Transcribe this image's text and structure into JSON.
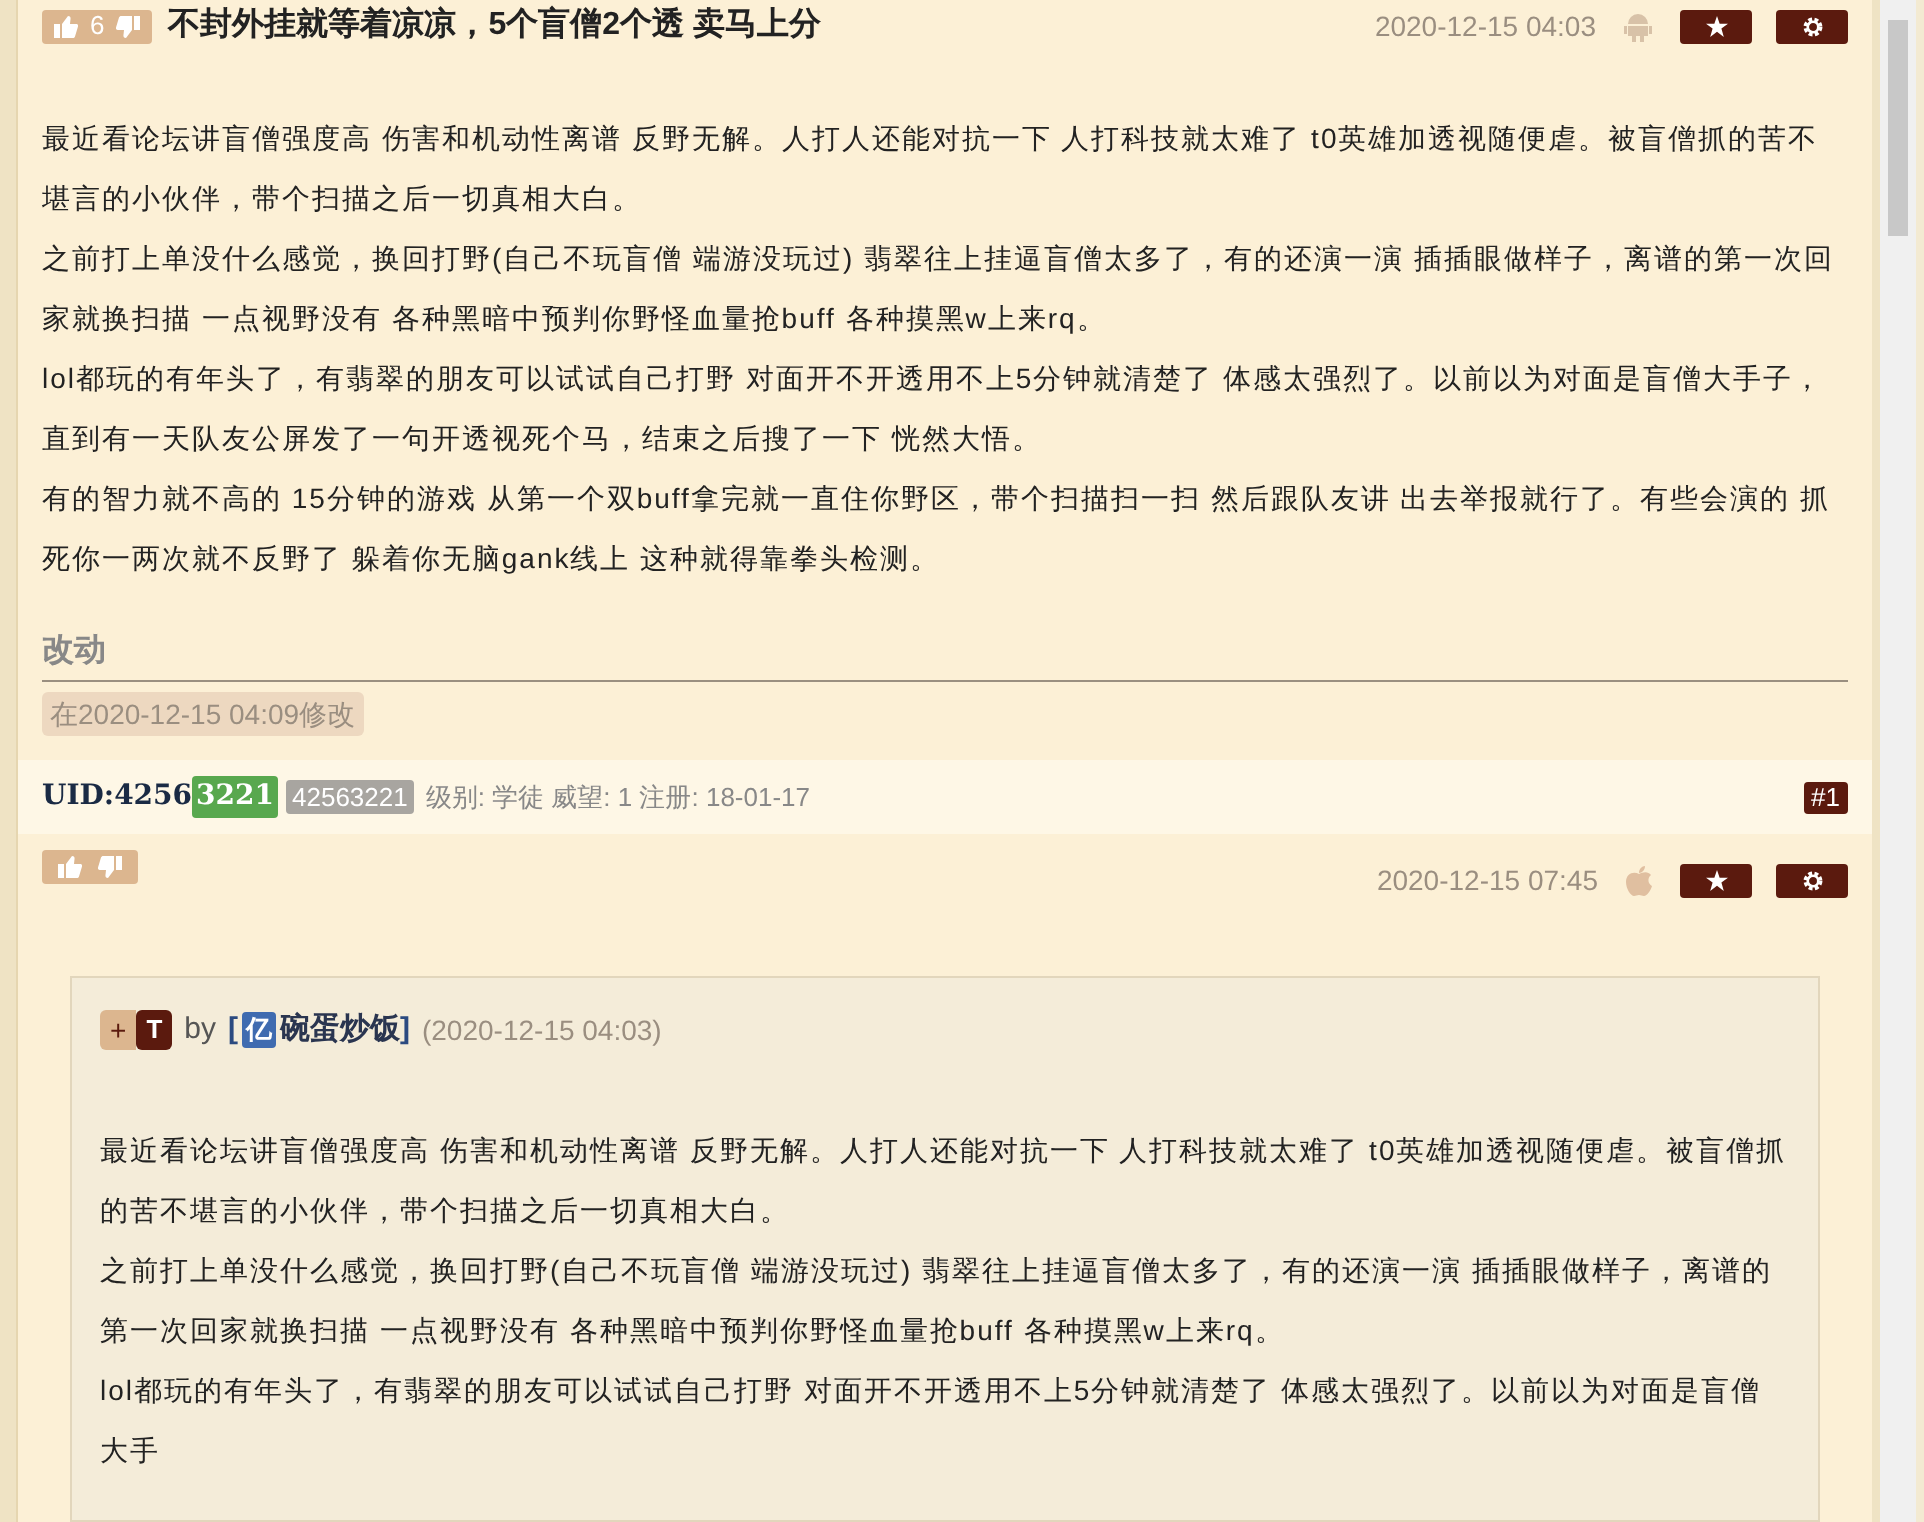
{
  "post": {
    "votes": "6",
    "title": "不封外挂就等着凉凉，5个盲僧2个透 卖马上分",
    "date": "2020-12-15 04:03",
    "device": {
      "kind": "android"
    },
    "paragraphs": [
      "最近看论坛讲盲僧强度高 伤害和机动性离谱 反野无解。人打人还能对抗一下 人打科技就太难了 t0英雄加透视随便虐。被盲僧抓的苦不堪言的小伙伴，带个扫描之后一切真相大白。",
      "之前打上单没什么感觉，换回打野(自己不玩盲僧 端游没玩过) 翡翠往上挂逼盲僧太多了，有的还演一演 插插眼做样子，离谱的第一次回家就换扫描 一点视野没有 各种黑暗中预判你野怪血量抢buff 各种摸黑w上来rq。",
      "lol都玩的有年头了，有翡翠的朋友可以试试自己打野 对面开不开透用不上5分钟就清楚了 体感太强烈了。以前以为对面是盲僧大手子，直到有一天队友公屏发了一句开透视死个马，结束之后搜了一下 恍然大悟。",
      "有的智力就不高的 15分钟的游戏 从第一个双buff拿完就一直住你野区，带个扫描扫一扫 然后跟队友讲 出去举报就行了。有些会演的 抓死你一两次就不反野了 躲着你无脑gank线上 这种就得靠拳头检测。"
    ],
    "edit_heading": "改动",
    "edit_note": "在2020-12-15 04:09修改"
  },
  "author": {
    "uid_prefix": "UID:4256",
    "uid_highlight": "3221",
    "uid_full": "42563221",
    "meta": "级别: 学徒 威望: 1 注册: 18-01-17",
    "floor": "#1"
  },
  "reply": {
    "date": "2020-12-15 07:45",
    "device": {
      "kind": "apple"
    },
    "quote": {
      "plus": "+",
      "tag": "T",
      "by": "by",
      "open": "[",
      "avatar": "亿",
      "user": "碗蛋炒饭",
      "close": "]",
      "date": "(2020-12-15 04:03)",
      "paragraphs": [
        "最近看论坛讲盲僧强度高 伤害和机动性离谱 反野无解。人打人还能对抗一下 人打科技就太难了 t0英雄加透视随便虐。被盲僧抓的苦不堪言的小伙伴，带个扫描之后一切真相大白。",
        "之前打上单没什么感觉，换回打野(自己不玩盲僧 端游没玩过) 翡翠往上挂逼盲僧太多了，有的还演一演 插插眼做样子，离谱的第一次回家就换扫描 一点视野没有 各种黑暗中预判你野怪血量抢buff 各种摸黑w上来rq。",
        "lol都玩的有年头了，有翡翠的朋友可以试试自己打野 对面开不开透用不上5分钟就清楚了 体感太强烈了。以前以为对面是盲僧大手"
      ]
    }
  }
}
